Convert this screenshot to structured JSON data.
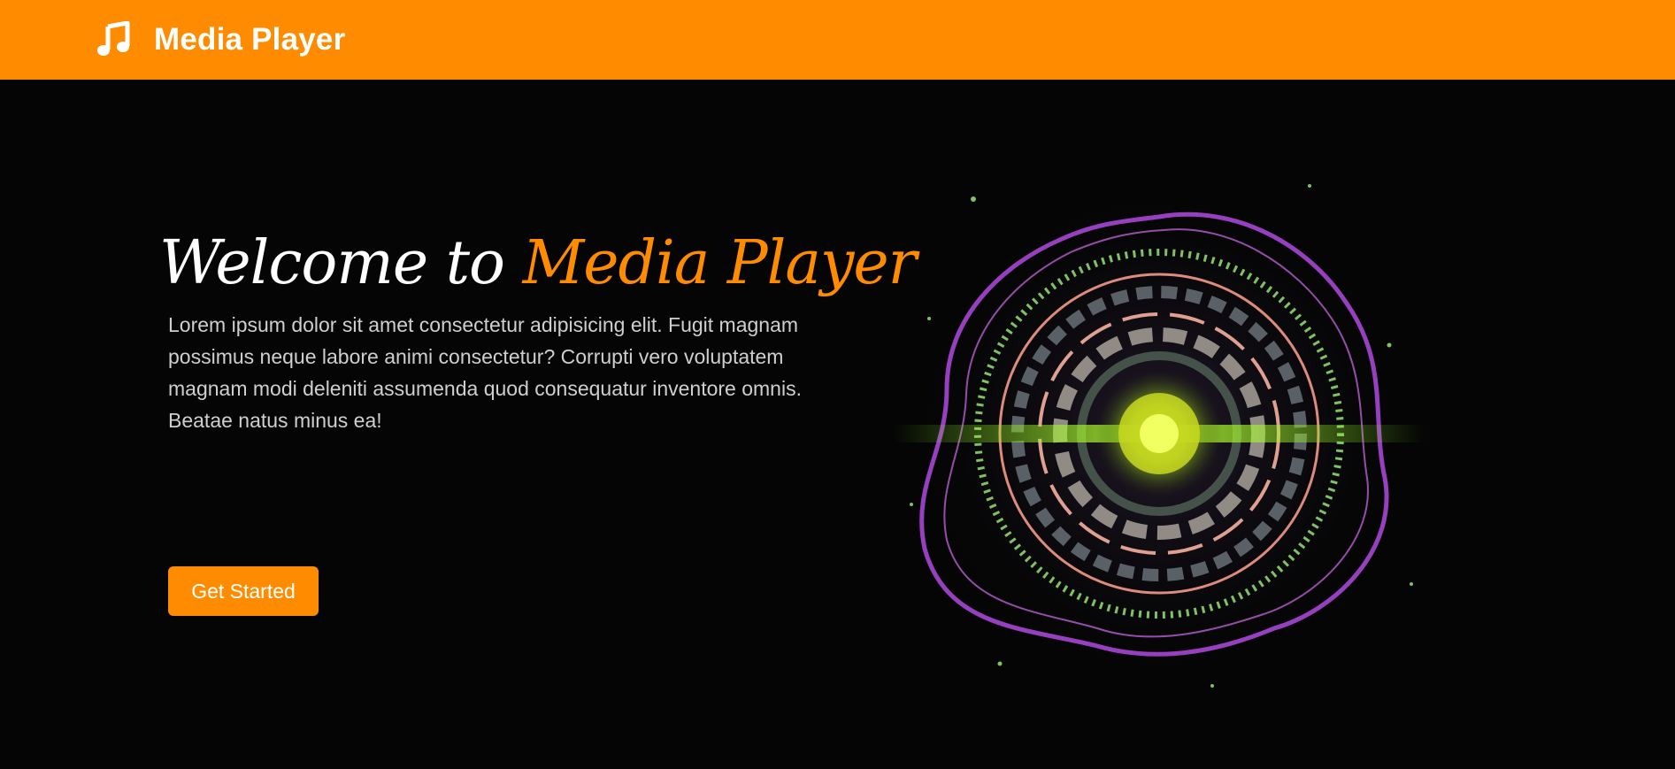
{
  "navbar": {
    "brand_icon": "music-note-icon",
    "brand_name": "Media Player",
    "background_color": "#ff8c00"
  },
  "hero": {
    "title_prefix": "Welcome to",
    "title_highlight": "Media Player",
    "description": "Lorem ipsum dolor sit amet consectetur adipisicing elit. Fugit magnam possimus neque labore animi consectetur? Corrupti vero voluptatem magnam modi deleniti assumenda quod consequatur inventore omnis. Beatae natus minus ea!",
    "cta_label": "Get Started",
    "accent_color": "#ff8c00",
    "visual": "audio-visualizer-graphic"
  }
}
